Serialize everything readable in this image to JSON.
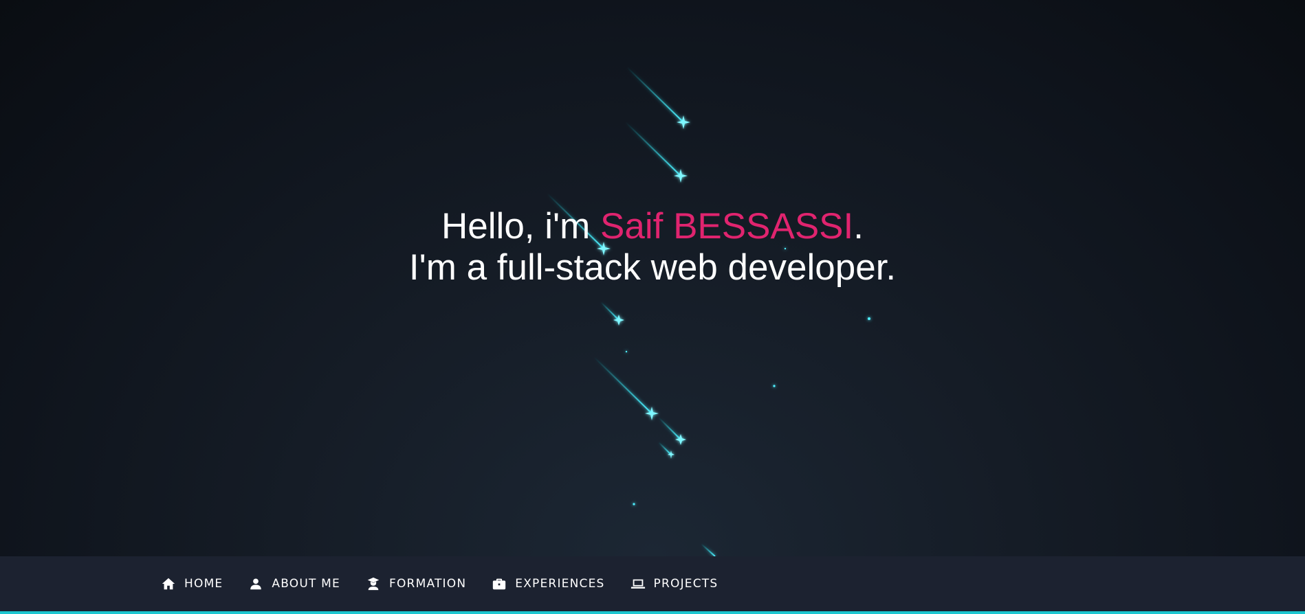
{
  "hero": {
    "greeting_prefix": "Hello, i'm ",
    "name": "Saif BESSASSI",
    "greeting_suffix": ".",
    "tagline": "I'm a full-stack web developer."
  },
  "nav": {
    "items": [
      {
        "label": "HOME",
        "icon": "home-icon"
      },
      {
        "label": "ABOUT ME",
        "icon": "person-icon"
      },
      {
        "label": "FORMATION",
        "icon": "graduate-icon"
      },
      {
        "label": "EXPERIENCES",
        "icon": "briefcase-icon"
      },
      {
        "label": "PROJECTS",
        "icon": "laptop-icon"
      }
    ]
  },
  "colors": {
    "accent_name": "#e0246f",
    "star": "#1ec5cf",
    "nav_bg": "#1c2230",
    "nav_underline": "#1ec5cf"
  }
}
